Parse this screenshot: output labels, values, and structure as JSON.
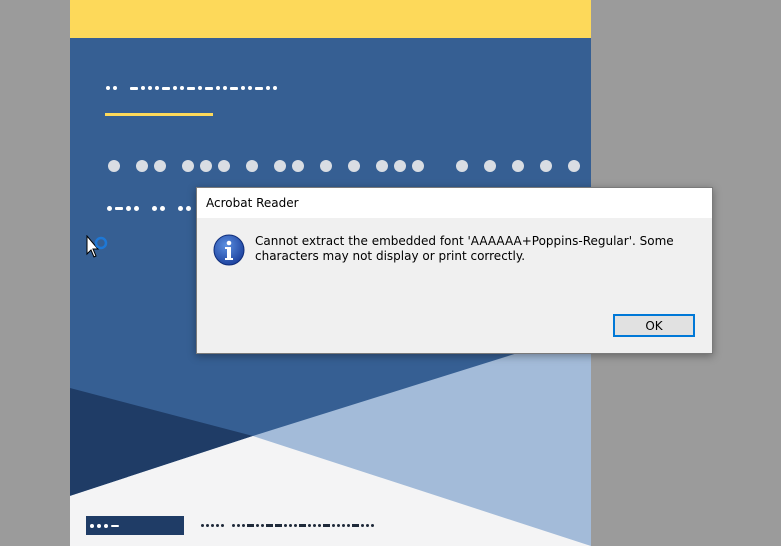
{
  "dialog": {
    "title": "Acrobat Reader",
    "message": "Cannot extract the embedded font 'AAAAAA+Poppins-Regular'. Some characters may not display or print correctly.",
    "ok_label": "OK",
    "icon": "info-icon"
  },
  "colors": {
    "page_bg": "#365f93",
    "accent_yellow": "#fdd95a",
    "backdrop": "#9b9b9b",
    "focus_border": "#0078d7"
  }
}
